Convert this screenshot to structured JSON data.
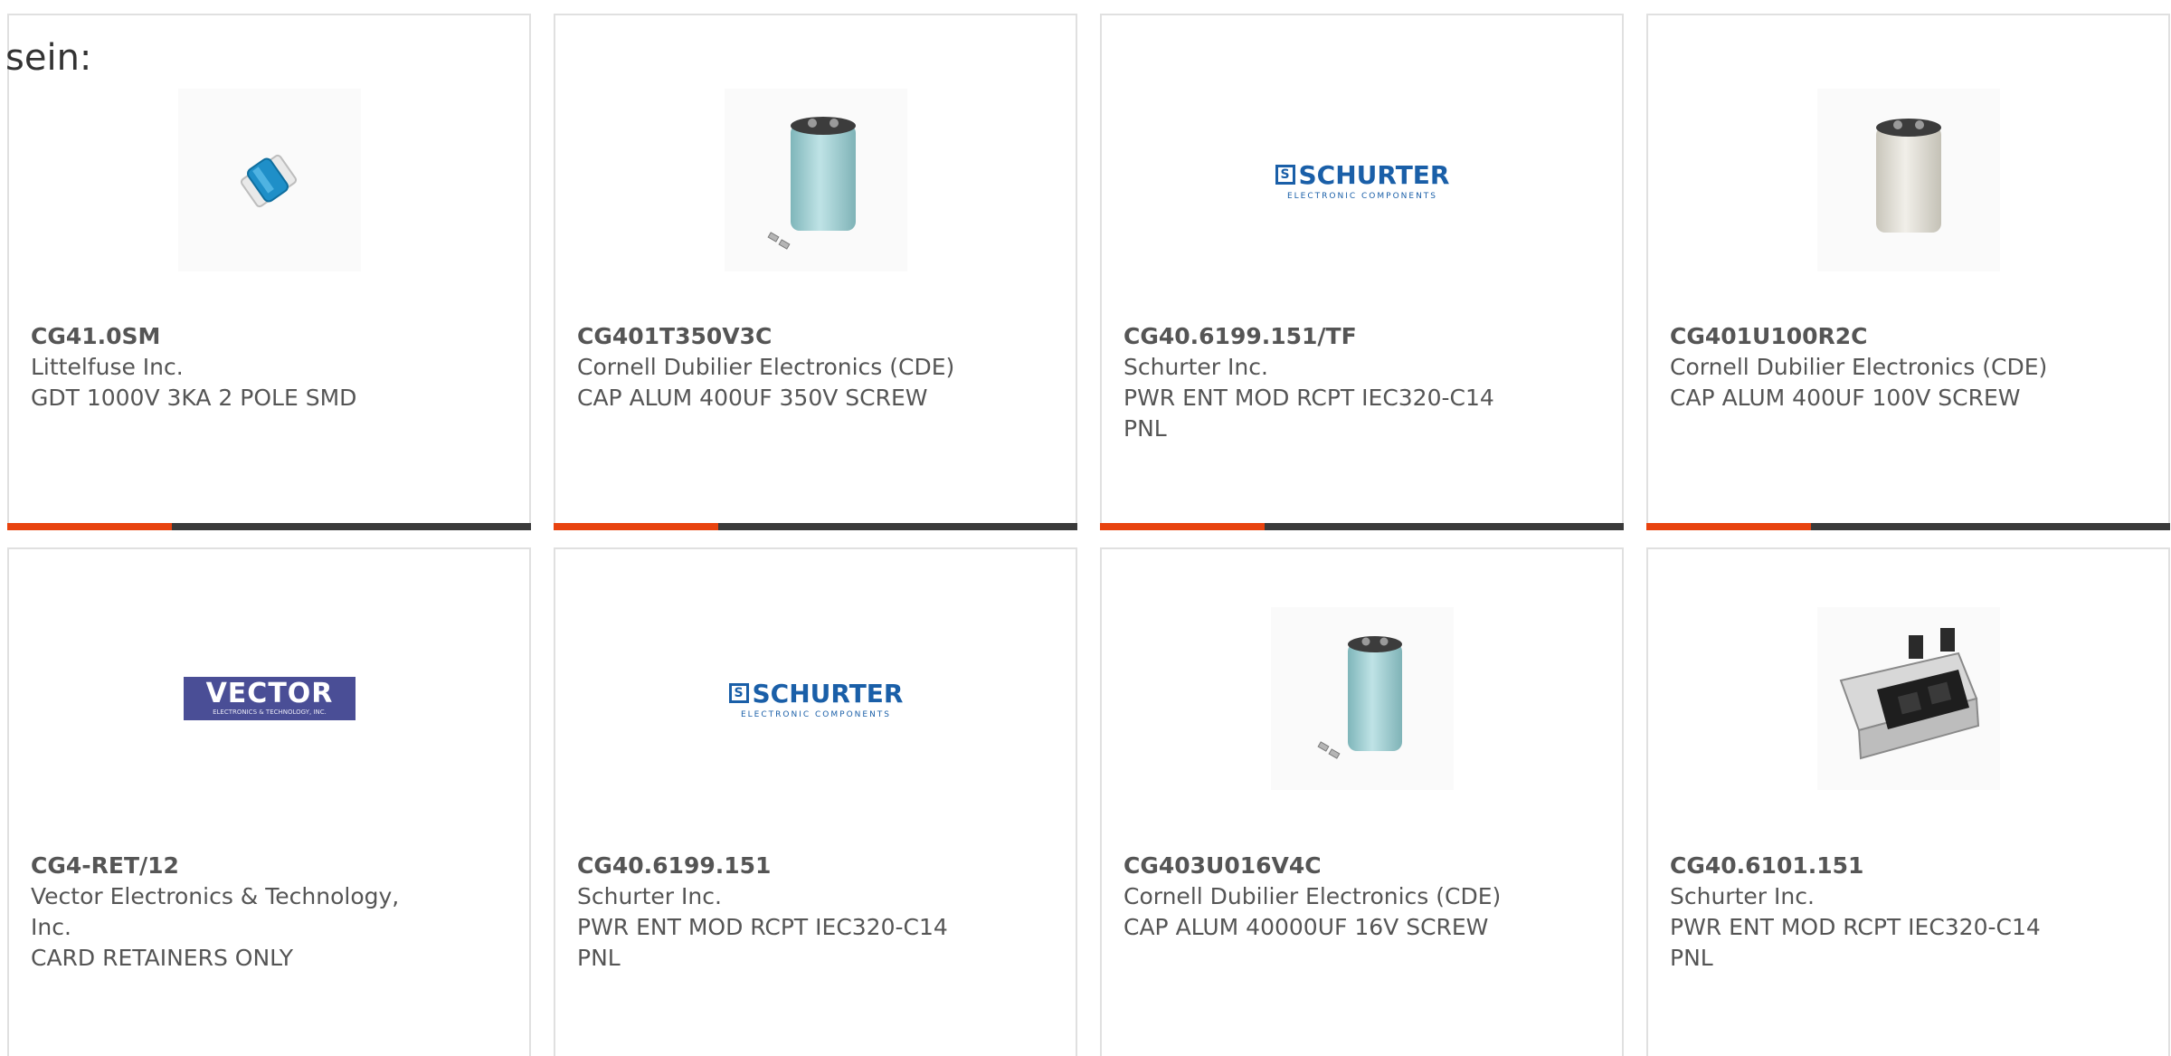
{
  "cut_text": "sein:",
  "colors": {
    "accent": "#e8430f",
    "bar": "#3a3a3a",
    "card_border": "#e0e0e0",
    "text": "#555555",
    "schurter_blue": "#1a5fa8",
    "vector_purple": "#4a4e96",
    "capacitor_teal": "#9fcdd0",
    "capacitor_cream": "#dedcd3"
  },
  "products": [
    {
      "part_number": "CG41.0SM",
      "manufacturer": "Littelfuse Inc.",
      "description": "GDT 1000V 3KA 2 POLE SMD",
      "image_icon": "gdt-component-icon"
    },
    {
      "part_number": "CG401T350V3C",
      "manufacturer": "Cornell Dubilier Electronics (CDE)",
      "description": "CAP ALUM 400UF 350V SCREW",
      "image_icon": "capacitor-teal-icon"
    },
    {
      "part_number": "CG40.6199.151/TF",
      "manufacturer": "Schurter Inc.",
      "description": "PWR ENT MOD RCPT IEC320-C14 PNL",
      "image_icon": "schurter-logo"
    },
    {
      "part_number": "CG401U100R2C",
      "manufacturer": "Cornell Dubilier Electronics (CDE)",
      "description": "CAP ALUM 400UF 100V SCREW",
      "image_icon": "capacitor-cream-icon"
    },
    {
      "part_number": "CG4-RET/12",
      "manufacturer": "Vector Electronics & Technology, Inc.",
      "description": "CARD RETAINERS ONLY",
      "image_icon": "vector-logo"
    },
    {
      "part_number": "CG40.6199.151",
      "manufacturer": "Schurter Inc.",
      "description": "PWR ENT MOD RCPT IEC320-C14 PNL",
      "image_icon": "schurter-logo"
    },
    {
      "part_number": "CG403U016V4C",
      "manufacturer": "Cornell Dubilier Electronics (CDE)",
      "description": "CAP ALUM 40000UF 16V SCREW",
      "image_icon": "capacitor-teal-icon"
    },
    {
      "part_number": "CG40.6101.151",
      "manufacturer": "Schurter Inc.",
      "description": "PWR ENT MOD RCPT IEC320-C14 PNL",
      "image_icon": "power-entry-module-icon"
    }
  ],
  "logos": {
    "schurter_name": "SCHURTER",
    "schurter_tagline": "ELECTRONIC COMPONENTS",
    "vector_name": "VECTOR",
    "vector_tagline": "ELECTRONICS & TECHNOLOGY, INC."
  }
}
